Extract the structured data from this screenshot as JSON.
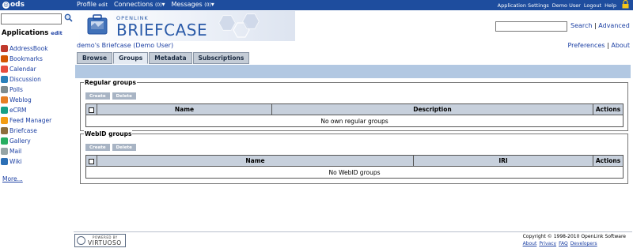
{
  "topbar": {
    "logo": "ods",
    "menu": [
      {
        "label": "Profile",
        "suffix": "edit"
      },
      {
        "label": "Connections",
        "suffix": "(0)"
      },
      {
        "label": "Messages",
        "suffix": "(0)"
      }
    ],
    "right_links": [
      "Application Settings",
      "Demo User",
      "Logout",
      "Help"
    ]
  },
  "sidebar": {
    "title": "Applications",
    "edit": "edit",
    "items": [
      {
        "label": "AddressBook",
        "icon": "addressbook-icon",
        "color": "#c0392b"
      },
      {
        "label": "Bookmarks",
        "icon": "bookmarks-icon",
        "color": "#d35400"
      },
      {
        "label": "Calendar",
        "icon": "calendar-icon",
        "color": "#e74c3c"
      },
      {
        "label": "Discussion",
        "icon": "discussion-icon",
        "color": "#2980b9"
      },
      {
        "label": "Polls",
        "icon": "polls-icon",
        "color": "#7f8c8d"
      },
      {
        "label": "Weblog",
        "icon": "weblog-icon",
        "color": "#e67e22"
      },
      {
        "label": "eCRM",
        "icon": "ecrm-icon",
        "color": "#16a085"
      },
      {
        "label": "Feed Manager",
        "icon": "feed-icon",
        "color": "#f39c12"
      },
      {
        "label": "Briefcase",
        "icon": "briefcase-icon",
        "color": "#8e6e3b"
      },
      {
        "label": "Gallery",
        "icon": "gallery-icon",
        "color": "#27ae60"
      },
      {
        "label": "Mail",
        "icon": "mail-icon",
        "color": "#95a5a6"
      },
      {
        "label": "Wiki",
        "icon": "wiki-icon",
        "color": "#2c6fb5"
      }
    ],
    "more": "More..."
  },
  "banner": {
    "small": "OPENLINK",
    "title": "BRIEFCASE"
  },
  "search": {
    "search_label": "Search",
    "separator": "|",
    "advanced_label": "Advanced"
  },
  "owner": {
    "briefcase": "demo's Briefcase",
    "user": "(Demo User)"
  },
  "prefs": {
    "preferences": "Preferences",
    "separator": "|",
    "about": "About"
  },
  "tabs": [
    "Browse",
    "Groups",
    "Metadata",
    "Subscriptions"
  ],
  "regular_groups": {
    "title": "Regular groups",
    "buttons": [
      "Create",
      "Delete"
    ],
    "columns": [
      "Name",
      "Description",
      "Actions"
    ],
    "empty": "No own regular groups"
  },
  "webid_groups": {
    "title": "WebID groups",
    "buttons": [
      "Create",
      "Delete"
    ],
    "columns": [
      "Name",
      "IRI",
      "Actions"
    ],
    "empty": "No WebID groups"
  },
  "footer": {
    "powered": "POWERED BY",
    "virtuoso": "VIRTUOSO",
    "copyright": "Copyright © 1998-2010 OpenLink Software",
    "links": [
      "About",
      "Privacy",
      "FAQ",
      "Developers"
    ]
  },
  "colors": {
    "topbar": "#1e4d9e",
    "tab_strip": "#b2c8e2",
    "link": "#1b3fa3"
  }
}
